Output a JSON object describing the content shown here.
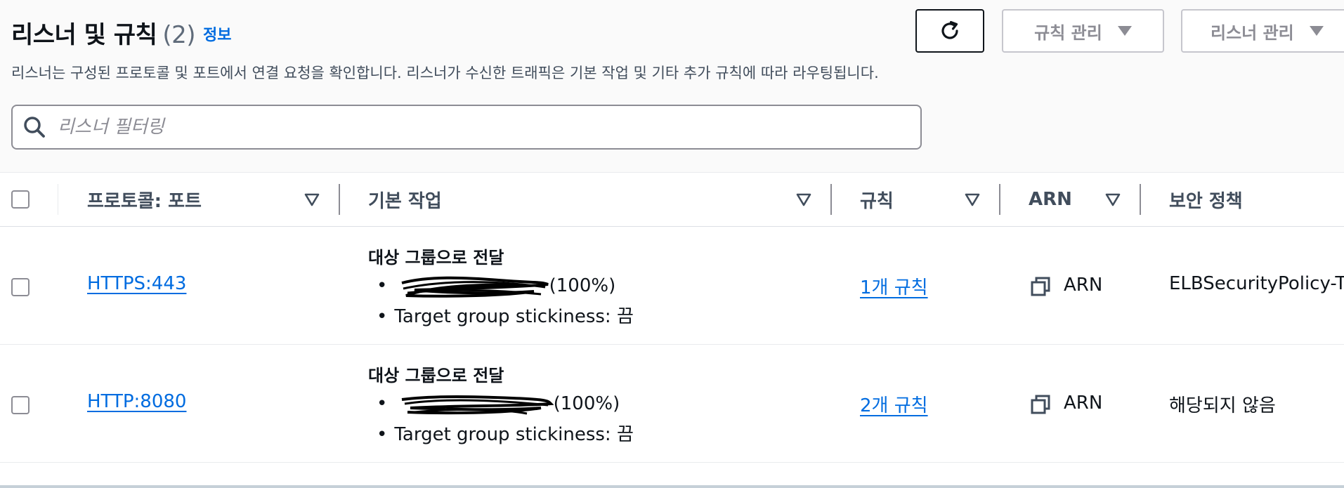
{
  "header": {
    "title": "리스너 및 규칙",
    "count": "(2)",
    "info_link": "정보",
    "description": "리스너는 구성된 프로토콜 및 포트에서 연결 요청을 확인합니다. 리스너가 수신한 트래픽은 기본 작업 및 기타 추가 규칙에 따라 라우팅됩니다."
  },
  "toolbar": {
    "refresh_icon": "refresh-icon",
    "manage_rules_label": "규칙 관리",
    "manage_listeners_label": "리스너 관리"
  },
  "search": {
    "placeholder": "리스너 필터링",
    "value": ""
  },
  "table": {
    "columns": [
      "프로토콜: 포트",
      "기본 작업",
      "규칙",
      "ARN",
      "보안 정책"
    ],
    "rows": [
      {
        "protocol_port": "HTTPS:443",
        "action_title": "대상 그룹으로 전달",
        "target_group_weight": "(100%)",
        "stickiness": "Target group stickiness: 끔",
        "rules": "1개 규칙",
        "arn_label": "ARN",
        "security_policy": "ELBSecurityPolicy-T"
      },
      {
        "protocol_port": "HTTP:8080",
        "action_title": "대상 그룹으로 전달",
        "target_group_weight": "(100%)",
        "stickiness": "Target group stickiness: 끔",
        "rules": "2개 규칙",
        "arn_label": "ARN",
        "security_policy": "해당되지 않음"
      }
    ]
  },
  "colors": {
    "link": "#006ce0",
    "text": "#0f141a",
    "muted": "#8c8c94",
    "header_bg": "#fafafa"
  }
}
